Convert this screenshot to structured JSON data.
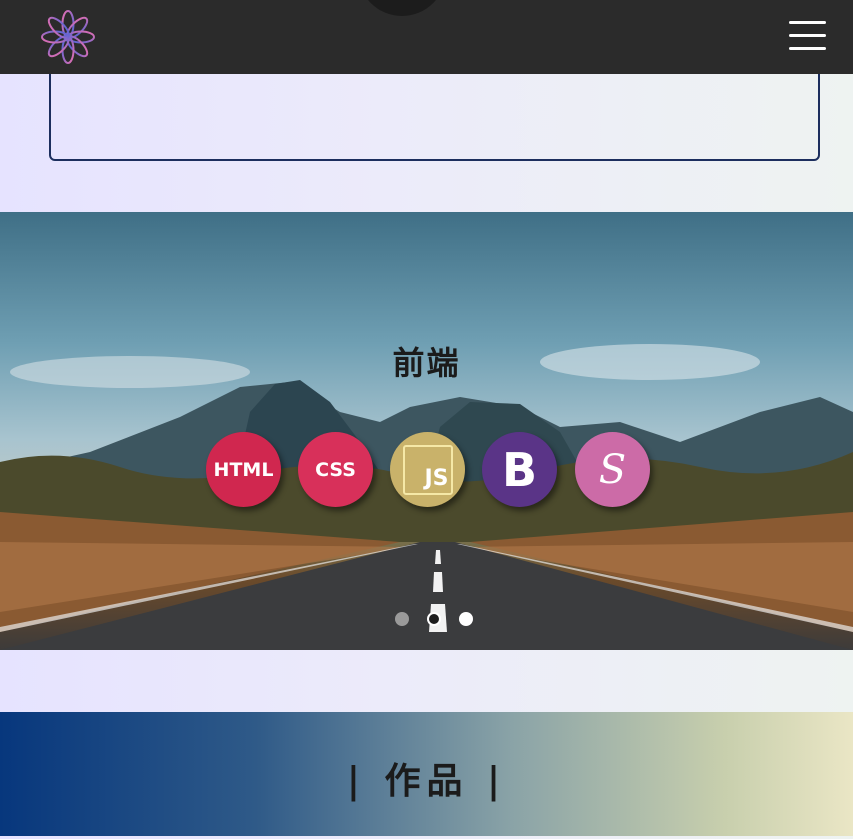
{
  "navbar": {
    "logo_icon": "lotus-flower-icon",
    "menu_icon": "hamburger-menu-icon"
  },
  "skills": {
    "title": "前端",
    "items": [
      {
        "label": "HTML",
        "icon": "html-icon",
        "color": "#d0274f"
      },
      {
        "label": "CSS",
        "icon": "css-icon",
        "color": "#d8305a"
      },
      {
        "label": "JS",
        "icon": "javascript-icon",
        "color": "#c9b26a"
      },
      {
        "label": "B",
        "icon": "bootstrap-icon",
        "color": "#5a3487"
      },
      {
        "label": "S",
        "icon": "sass-icon",
        "color": "#cc6ba7"
      }
    ],
    "slide_count": 3,
    "active_slide": 2
  },
  "works": {
    "title": "| 作品 |"
  },
  "colors": {
    "navbar_bg": "#2b2b2b",
    "box_border": "#1c2e5e",
    "works_gradient_start": "#07377d",
    "works_gradient_end": "#eae6c5"
  }
}
